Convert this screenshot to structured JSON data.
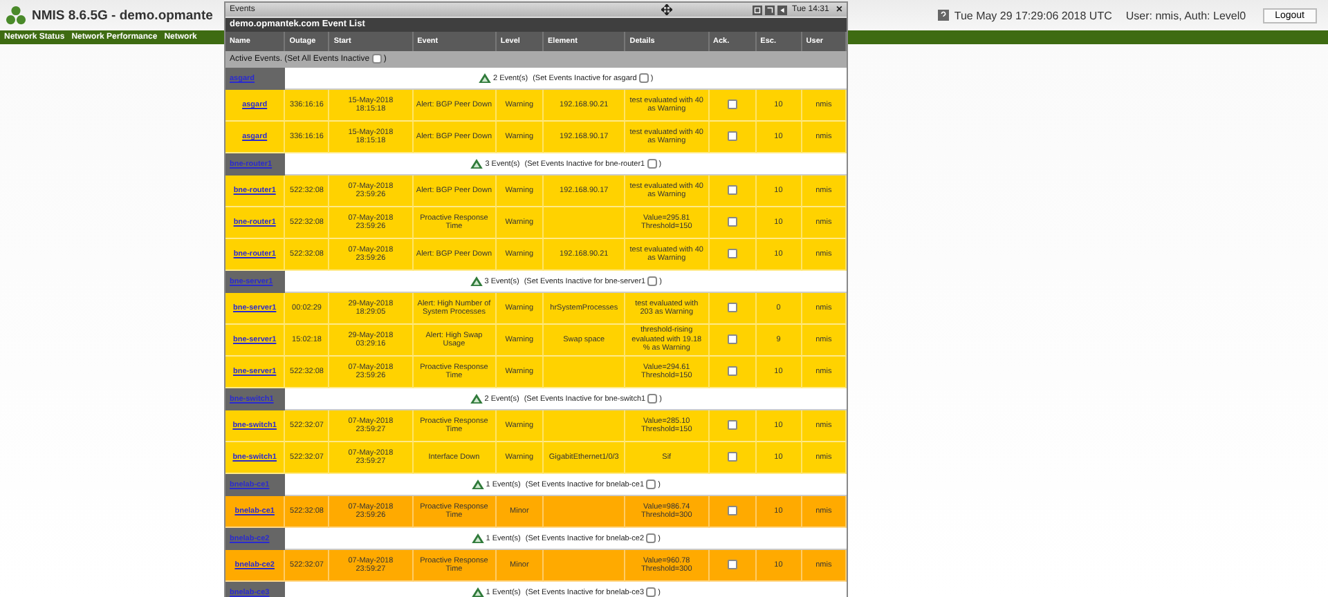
{
  "page_header": {
    "title": "NMIS 8.6.5G - demo.opmante",
    "datetime": "Tue May 29 17:29:06 2018 UTC",
    "user": "User: nmis, Auth: Level0",
    "logout": "Logout"
  },
  "nav": [
    "Network Status",
    "Network Performance",
    "Network"
  ],
  "events_window": {
    "title": "Events",
    "clock": "Tue 14:31",
    "close": "×",
    "subtitle": "demo.opmantek.com Event List",
    "columns": [
      "Name",
      "Outage",
      "Start",
      "Event",
      "Level",
      "Element",
      "Details",
      "Ack.",
      "Esc.",
      "User"
    ],
    "active_events": {
      "label": "Active Events. (Set All Events Inactive",
      "close_paren": ")",
      "checked": false
    },
    "groups": [
      {
        "node": "asgard",
        "count": "2 Event(s)",
        "set_inactive": "(Set Events Inactive for asgard",
        "close_paren": ")",
        "checked": false,
        "events": [
          {
            "name": "asgard",
            "outage": "336:16:16",
            "start": "15-May-2018 18:15:18",
            "event": "Alert: BGP Peer Down",
            "level": "Warning",
            "element": "192.168.90.21",
            "details": "test evaluated with 40 as Warning",
            "acknowledged": false,
            "escalation": "10",
            "user": "nmis",
            "color": "#ffd200"
          },
          {
            "name": "asgard",
            "outage": "336:16:16",
            "start": "15-May-2018 18:15:18",
            "event": "Alert: BGP Peer Down",
            "level": "Warning",
            "element": "192.168.90.17",
            "details": "test evaluated with 40 as Warning",
            "acknowledged": false,
            "escalation": "10",
            "user": "nmis",
            "color": "#ffd200"
          }
        ]
      },
      {
        "node": "bne-router1",
        "count": "3 Event(s)",
        "set_inactive": "(Set Events Inactive for bne-router1",
        "close_paren": ")",
        "checked": false,
        "events": [
          {
            "name": "bne-router1",
            "outage": "522:32:08",
            "start": "07-May-2018 23:59:26",
            "event": "Alert: BGP Peer Down",
            "level": "Warning",
            "element": "192.168.90.17",
            "details": "test evaluated with 40 as Warning",
            "acknowledged": false,
            "escalation": "10",
            "user": "nmis",
            "color": "#ffd200"
          },
          {
            "name": "bne-router1",
            "outage": "522:32:08",
            "start": "07-May-2018 23:59:26",
            "event": "Proactive Response Time",
            "level": "Warning",
            "details": "Value=295.81 Threshold=150",
            "acknowledged": false,
            "escalation": "10",
            "user": "nmis",
            "color": "#ffd200"
          },
          {
            "name": "bne-router1",
            "outage": "522:32:08",
            "start": "07-May-2018 23:59:26",
            "event": "Alert: BGP Peer Down",
            "level": "Warning",
            "element": "192.168.90.21",
            "details": "test evaluated with 40 as Warning",
            "acknowledged": false,
            "escalation": "10",
            "user": "nmis",
            "color": "#ffd200"
          }
        ]
      },
      {
        "node": "bne-server1",
        "count": "3 Event(s)",
        "set_inactive": "(Set Events Inactive for bne-server1",
        "close_paren": ")",
        "checked": false,
        "events": [
          {
            "name": "bne-server1",
            "outage": "00:02:29",
            "start": "29-May-2018 18:29:05",
            "event": "Alert: High Number of System Processes",
            "level": "Warning",
            "element": "hrSystemProcesses",
            "details": "test evaluated with 203 as Warning",
            "acknowledged": false,
            "escalation": "0",
            "user": "nmis",
            "color": "#ffd200"
          },
          {
            "name": "bne-server1",
            "outage": "15:02:18",
            "start": "29-May-2018 03:29:16",
            "event": "Alert: High Swap Usage",
            "level": "Warning",
            "element": "Swap space",
            "details": "threshold-rising evaluated with 19.18 % as Warning",
            "acknowledged": false,
            "escalation": "9",
            "user": "nmis",
            "color": "#ffd200"
          },
          {
            "name": "bne-server1",
            "outage": "522:32:08",
            "start": "07-May-2018 23:59:26",
            "event": "Proactive Response Time",
            "level": "Warning",
            "details": "Value=294.61 Threshold=150",
            "acknowledged": false,
            "escalation": "10",
            "user": "nmis",
            "color": "#ffd200"
          }
        ]
      },
      {
        "node": "bne-switch1",
        "count": "2 Event(s)",
        "set_inactive": "(Set Events Inactive for bne-switch1",
        "close_paren": ")",
        "checked": false,
        "events": [
          {
            "name": "bne-switch1",
            "outage": "522:32:07",
            "start": "07-May-2018 23:59:27",
            "event": "Proactive Response Time",
            "level": "Warning",
            "details": "Value=285.10 Threshold=150",
            "acknowledged": false,
            "escalation": "10",
            "user": "nmis",
            "color": "#ffd200"
          },
          {
            "name": "bne-switch1",
            "outage": "522:32:07",
            "start": "07-May-2018 23:59:27",
            "event": "Interface Down",
            "level": "Warning",
            "element": "GigabitEthernet1/0/3",
            "details": "Sif",
            "acknowledged": false,
            "escalation": "10",
            "user": "nmis",
            "color": "#ffd200"
          }
        ]
      },
      {
        "node": "bnelab-ce1",
        "count": "1 Event(s)",
        "set_inactive": "(Set Events Inactive for bnelab-ce1",
        "close_paren": ")",
        "checked": false,
        "events": [
          {
            "name": "bnelab-ce1",
            "outage": "522:32:08",
            "start": "07-May-2018 23:59:26",
            "event": "Proactive Response Time",
            "level": "Minor",
            "details": "Value=986.74 Threshold=300",
            "acknowledged": false,
            "escalation": "10",
            "user": "nmis",
            "color": "#ffaa00"
          }
        ]
      },
      {
        "node": "bnelab-ce2",
        "count": "1 Event(s)",
        "set_inactive": "(Set Events Inactive for bnelab-ce2",
        "close_paren": ")",
        "checked": false,
        "events": [
          {
            "name": "bnelab-ce2",
            "outage": "522:32:07",
            "start": "07-May-2018 23:59:27",
            "event": "Proactive Response Time",
            "level": "Minor",
            "details": "Value=960.78 Threshold=300",
            "acknowledged": false,
            "escalation": "10",
            "user": "nmis",
            "color": "#ffaa00"
          }
        ]
      },
      {
        "node": "bnelab-ce3",
        "count": "1 Event(s)",
        "set_inactive": "(Set Events Inactive for bnelab-ce3",
        "close_paren": ")",
        "checked": false
      }
    ]
  }
}
